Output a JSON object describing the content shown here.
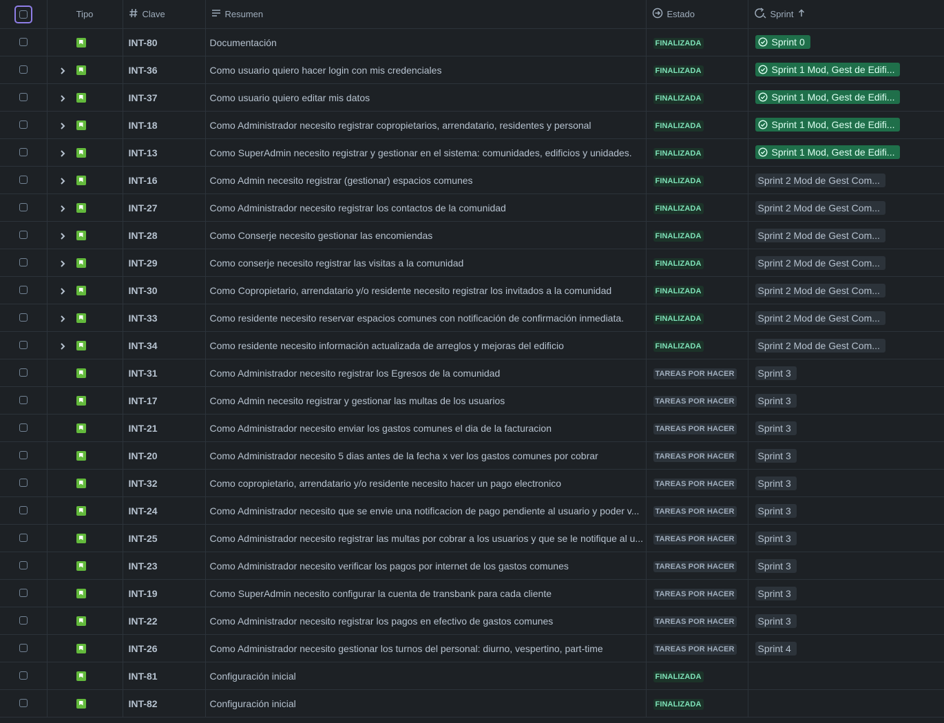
{
  "header": {
    "tipo": "Tipo",
    "clave": "Clave",
    "resumen": "Resumen",
    "estado": "Estado",
    "sprint": "Sprint"
  },
  "colors": {
    "done_bg": "#1c3329",
    "done_fg": "#7ee2b8",
    "closed_sprint": "#1f6f4a",
    "story": "#63ba3c",
    "select_outline": "#8f7ee7"
  },
  "rows": [
    {
      "key": "INT-80",
      "summary": "Documentación",
      "status": "FINALIZADA",
      "status_type": "done",
      "sprint": "Sprint 0",
      "sprint_closed": true,
      "expand": false
    },
    {
      "key": "INT-36",
      "summary": "Como usuario quiero hacer login con mis credenciales",
      "status": "FINALIZADA",
      "status_type": "done",
      "sprint": "Sprint 1 Mod, Gest de Edifi...",
      "sprint_closed": true,
      "expand": true
    },
    {
      "key": "INT-37",
      "summary": "Como usuario quiero editar mis datos",
      "status": "FINALIZADA",
      "status_type": "done",
      "sprint": "Sprint 1 Mod, Gest de Edifi...",
      "sprint_closed": true,
      "expand": true
    },
    {
      "key": "INT-18",
      "summary": "Como Administrador necesito registrar copropietarios, arrendatario, residentes y personal",
      "status": "FINALIZADA",
      "status_type": "done",
      "sprint": "Sprint 1 Mod, Gest de Edifi...",
      "sprint_closed": true,
      "expand": true
    },
    {
      "key": "INT-13",
      "summary": "Como SuperAdmin necesito registrar y gestionar en el sistema: comunidades, edificios y unidades.",
      "status": "FINALIZADA",
      "status_type": "done",
      "sprint": "Sprint 1 Mod, Gest de Edifi...",
      "sprint_closed": true,
      "expand": true
    },
    {
      "key": "INT-16",
      "summary": "Como Admin necesito registrar (gestionar) espacios comunes",
      "status": "FINALIZADA",
      "status_type": "done",
      "sprint": "Sprint 2 Mod de Gest Com...",
      "sprint_closed": false,
      "expand": true
    },
    {
      "key": "INT-27",
      "summary": "Como Administrador necesito registrar los contactos de la comunidad",
      "status": "FINALIZADA",
      "status_type": "done",
      "sprint": "Sprint 2 Mod de Gest Com...",
      "sprint_closed": false,
      "expand": true
    },
    {
      "key": "INT-28",
      "summary": "Como Conserje necesito gestionar las encomiendas",
      "status": "FINALIZADA",
      "status_type": "done",
      "sprint": "Sprint 2 Mod de Gest Com...",
      "sprint_closed": false,
      "expand": true
    },
    {
      "key": "INT-29",
      "summary": "Como conserje necesito registrar las visitas a la comunidad",
      "status": "FINALIZADA",
      "status_type": "done",
      "sprint": "Sprint 2 Mod de Gest Com...",
      "sprint_closed": false,
      "expand": true
    },
    {
      "key": "INT-30",
      "summary": "Como Copropietario, arrendatario y/o residente necesito registrar los invitados a la comunidad",
      "status": "FINALIZADA",
      "status_type": "done",
      "sprint": "Sprint 2 Mod de Gest Com...",
      "sprint_closed": false,
      "expand": true
    },
    {
      "key": "INT-33",
      "summary": "Como residente necesito reservar espacios comunes con notificación de confirmación inmediata.",
      "status": "FINALIZADA",
      "status_type": "done",
      "sprint": "Sprint 2 Mod de Gest Com...",
      "sprint_closed": false,
      "expand": true
    },
    {
      "key": "INT-34",
      "summary": "Como residente necesito información actualizada de arreglos y mejoras del edificio",
      "status": "FINALIZADA",
      "status_type": "done",
      "sprint": "Sprint 2 Mod de Gest Com...",
      "sprint_closed": false,
      "expand": true
    },
    {
      "key": "INT-31",
      "summary": "Como Administrador necesito registrar los Egresos de la comunidad",
      "status": "TAREAS POR HACER",
      "status_type": "todo",
      "sprint": "Sprint 3",
      "sprint_closed": false,
      "expand": false
    },
    {
      "key": "INT-17",
      "summary": "Como Admin necesito registrar y gestionar las multas de los usuarios",
      "status": "TAREAS POR HACER",
      "status_type": "todo",
      "sprint": "Sprint 3",
      "sprint_closed": false,
      "expand": false
    },
    {
      "key": "INT-21",
      "summary": "Como Administrador necesito enviar los gastos comunes el dia de la facturacion",
      "status": "TAREAS POR HACER",
      "status_type": "todo",
      "sprint": "Sprint 3",
      "sprint_closed": false,
      "expand": false
    },
    {
      "key": "INT-20",
      "summary": "Como Administrador necesito 5 dias antes de la fecha x ver los gastos comunes por cobrar",
      "status": "TAREAS POR HACER",
      "status_type": "todo",
      "sprint": "Sprint 3",
      "sprint_closed": false,
      "expand": false
    },
    {
      "key": "INT-32",
      "summary": "Como copropietario, arrendatario y/o residente necesito hacer un pago electronico",
      "status": "TAREAS POR HACER",
      "status_type": "todo",
      "sprint": "Sprint 3",
      "sprint_closed": false,
      "expand": false
    },
    {
      "key": "INT-24",
      "summary": "Como Administrador necesito que se envie una notificacion de pago pendiente al usuario y poder v...",
      "status": "TAREAS POR HACER",
      "status_type": "todo",
      "sprint": "Sprint 3",
      "sprint_closed": false,
      "expand": false
    },
    {
      "key": "INT-25",
      "summary": "Como Administrador necesito registrar las multas por cobrar a los usuarios y que se le notifique al u...",
      "status": "TAREAS POR HACER",
      "status_type": "todo",
      "sprint": "Sprint 3",
      "sprint_closed": false,
      "expand": false
    },
    {
      "key": "INT-23",
      "summary": "Como Administrador necesito verificar los pagos por internet de los gastos comunes",
      "status": "TAREAS POR HACER",
      "status_type": "todo",
      "sprint": "Sprint 3",
      "sprint_closed": false,
      "expand": false
    },
    {
      "key": "INT-19",
      "summary": "Como SuperAdmin necesito configurar la cuenta de transbank para cada cliente",
      "status": "TAREAS POR HACER",
      "status_type": "todo",
      "sprint": "Sprint 3",
      "sprint_closed": false,
      "expand": false
    },
    {
      "key": "INT-22",
      "summary": "Como Administrador necesito registrar los pagos en efectivo de gastos comunes",
      "status": "TAREAS POR HACER",
      "status_type": "todo",
      "sprint": "Sprint 3",
      "sprint_closed": false,
      "expand": false
    },
    {
      "key": "INT-26",
      "summary": "Como Administrador necesito gestionar los turnos del personal: diurno, vespertino, part-time",
      "status": "TAREAS POR HACER",
      "status_type": "todo",
      "sprint": "Sprint 4",
      "sprint_closed": false,
      "expand": false
    },
    {
      "key": "INT-81",
      "summary": "Configuración inicial",
      "status": "FINALIZADA",
      "status_type": "done",
      "sprint": "",
      "sprint_closed": false,
      "expand": false
    },
    {
      "key": "INT-82",
      "summary": "Configuración inicial",
      "status": "FINALIZADA",
      "status_type": "done",
      "sprint": "",
      "sprint_closed": false,
      "expand": false
    }
  ]
}
